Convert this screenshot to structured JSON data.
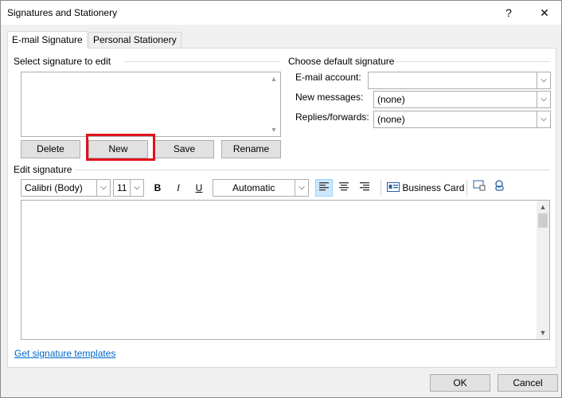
{
  "window": {
    "title": "Signatures and Stationery",
    "help": "?",
    "close": "✕"
  },
  "tabs": [
    {
      "label": "E-mail Signature",
      "active": true
    },
    {
      "label": "Personal Stationery",
      "active": false
    }
  ],
  "select_signature": {
    "label": "Select signature to edit",
    "buttons": {
      "delete": "Delete",
      "new": "New",
      "save": "Save",
      "rename": "Rename"
    }
  },
  "default_signature": {
    "label": "Choose default signature",
    "email_account_label": "E-mail account:",
    "email_account_value": "",
    "new_messages_label": "New messages:",
    "new_messages_value": "(none)",
    "replies_label": "Replies/forwards:",
    "replies_value": "(none)"
  },
  "edit_signature": {
    "label": "Edit signature",
    "font": "Calibri (Body)",
    "size": "11",
    "bold": "B",
    "italic": "I",
    "underline": "U",
    "color": "Automatic",
    "business_card": "Business Card"
  },
  "links": {
    "templates": "Get signature templates"
  },
  "footer": {
    "ok": "OK",
    "cancel": "Cancel"
  },
  "colors": {
    "highlight": "#e0121b",
    "link": "#0066cc",
    "align_active": "#cce8ff"
  },
  "icons": [
    "help-icon",
    "close-icon",
    "chevron-down-icon",
    "align-left-icon",
    "align-center-icon",
    "align-right-icon",
    "business-card-icon",
    "picture-icon",
    "hyperlink-icon"
  ]
}
